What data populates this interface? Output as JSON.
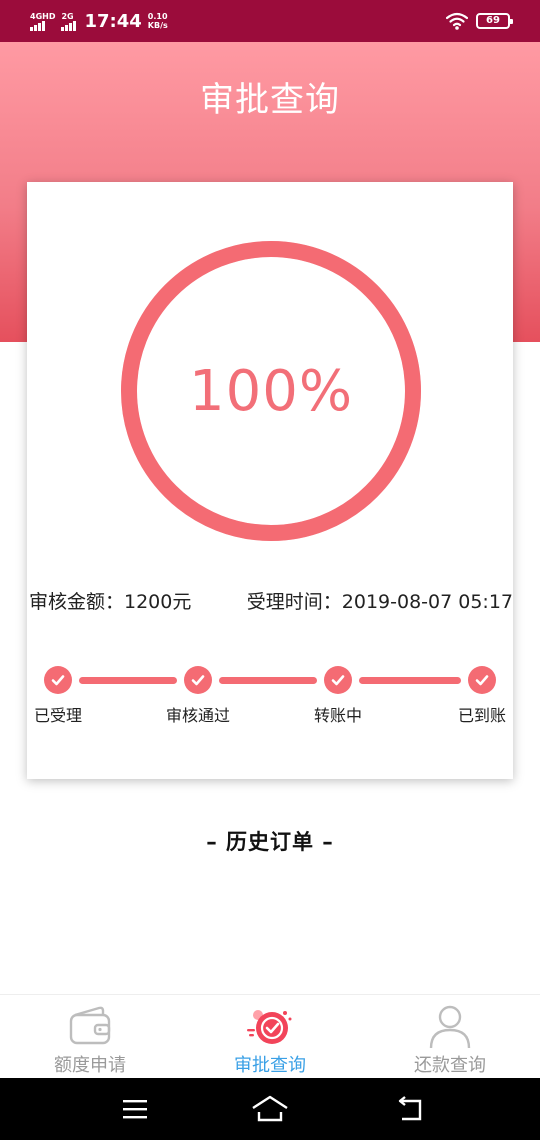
{
  "status_bar": {
    "network_primary": "4GHD",
    "network_secondary": "2G",
    "time": "17:44",
    "speed_value": "0.10",
    "speed_unit": "KB/s",
    "battery": "69",
    "icons": [
      "signal-icon",
      "signal-icon",
      "wifi-icon",
      "battery-icon"
    ]
  },
  "header": {
    "title": "审批查询"
  },
  "progress": {
    "label": "100%",
    "value": 1.0
  },
  "info": {
    "amount": "审核金额：1200元",
    "time": "受理时间：2019-08-07 05:17"
  },
  "steps": [
    {
      "label": "已受理",
      "done": true
    },
    {
      "label": "审核通过",
      "done": true
    },
    {
      "label": "转账中",
      "done": true
    },
    {
      "label": "已到账",
      "done": true
    }
  ],
  "history": {
    "title": "– 历史订单 –"
  },
  "tabs": [
    {
      "label": "额度申请",
      "icon": "wallet-icon",
      "active": false
    },
    {
      "label": "审批查询",
      "icon": "check-badge-icon",
      "active": true
    },
    {
      "label": "还款查询",
      "icon": "user-icon",
      "active": false
    }
  ],
  "colors": {
    "status_bar": "#9b0c3b",
    "header_top": "#ff9aa3",
    "header_bottom": "#e5505d",
    "accent": "#f46b73",
    "tab_active": "#3aa0e6",
    "tab_inactive": "#9a9a9a"
  }
}
